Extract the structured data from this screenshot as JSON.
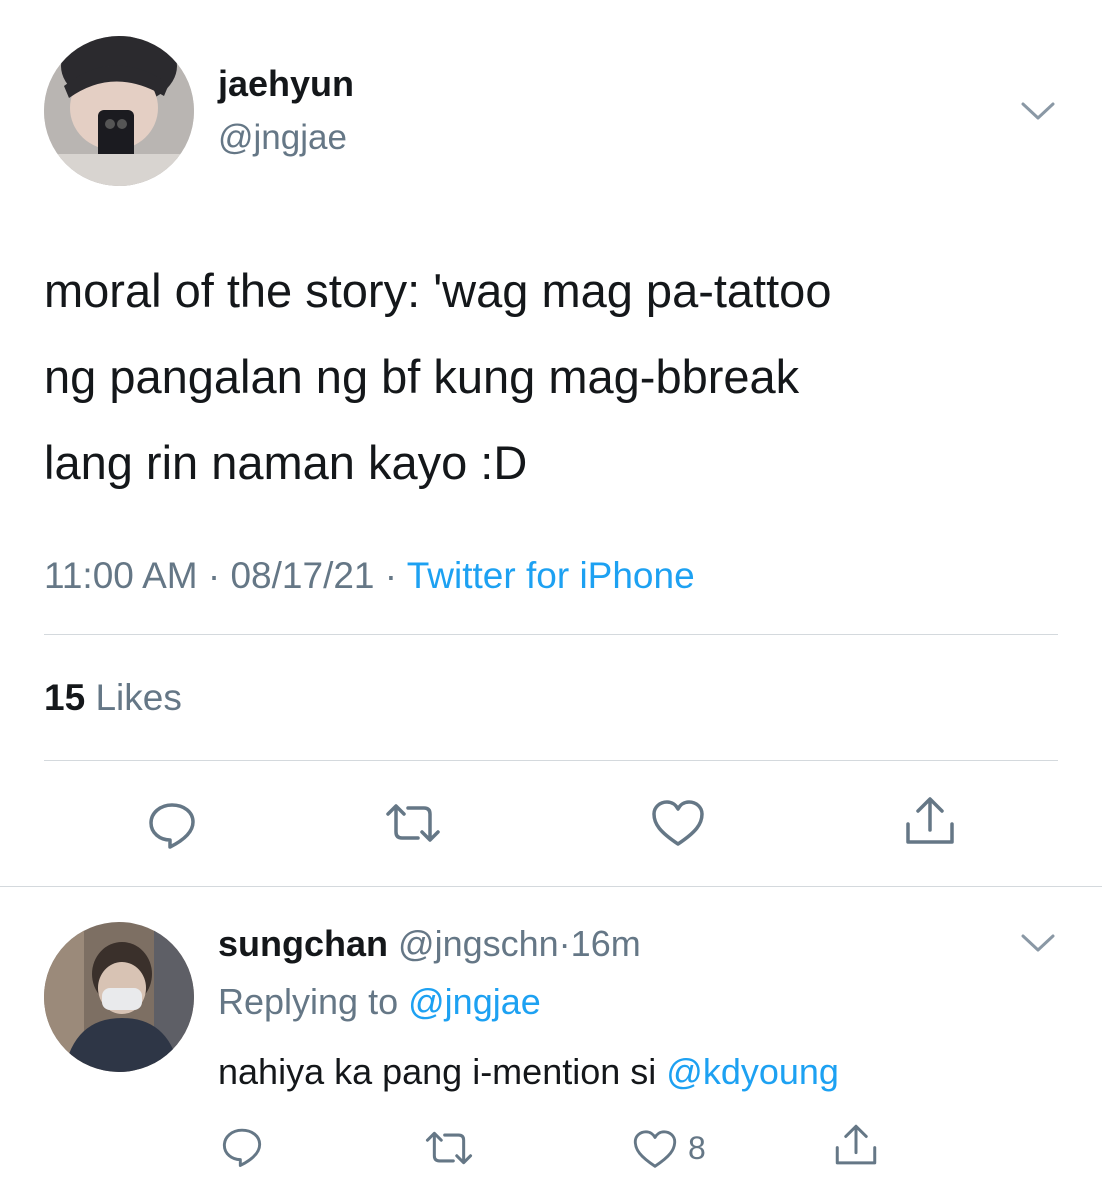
{
  "main_tweet": {
    "display_name": "jaehyun",
    "handle": "@jngjae",
    "text_lines": [
      "moral of the story: 'wag mag pa-tattoo",
      "ng pangalan ng bf kung mag-bbreak",
      "lang rin naman kayo :D"
    ],
    "time": "11:00 AM",
    "separator": "·",
    "date": "08/17/21",
    "source": "Twitter for iPhone",
    "likes_count": "15",
    "likes_label": "Likes"
  },
  "reply_tweet": {
    "display_name": "sungchan",
    "handle": "@jngschn",
    "separator": "·",
    "age": "16m",
    "replying_prefix": "Replying to",
    "replying_handle": "@jngjae",
    "text": "nahiya ka pang i-mention si",
    "mention": "@kdyoung",
    "like_count": "8"
  },
  "icons": {
    "menu": "chevron-down-icon",
    "reply": "reply-bubble-icon",
    "retweet": "retweet-icon",
    "like": "heart-icon",
    "share": "share-icon"
  },
  "colors": {
    "link": "#1da1f2",
    "secondary_text": "#657786",
    "icon": "#657786",
    "divider": "#d4d9dd"
  }
}
